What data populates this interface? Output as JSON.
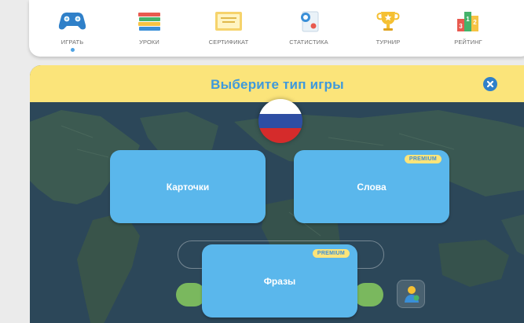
{
  "nav": {
    "items": [
      {
        "label": "ИГРАТЬ",
        "icon": "gamepad-icon",
        "active": true
      },
      {
        "label": "УРОКИ",
        "icon": "books-icon",
        "active": false
      },
      {
        "label": "СЕРТИФИКАТ",
        "icon": "certificate-icon",
        "active": false
      },
      {
        "label": "СТАТИСТИКА",
        "icon": "statistics-icon",
        "active": false
      },
      {
        "label": "ТУРНИР",
        "icon": "trophy-icon",
        "active": false
      },
      {
        "label": "РЕЙТИНГ",
        "icon": "podium-icon",
        "active": false
      }
    ],
    "podium": {
      "first": "1",
      "second": "2",
      "third": "3"
    }
  },
  "panel": {
    "title": "Выберите тип игры",
    "close_icon": "close-icon",
    "flag": "russia-flag-icon"
  },
  "games": [
    {
      "label": "Карточки",
      "premium": false
    },
    {
      "label": "Слова",
      "premium": true,
      "badge": "PREMIUM"
    },
    {
      "label": "Фразы",
      "premium": true,
      "badge": "PREMIUM"
    }
  ],
  "colors": {
    "accent": "#3e99dc",
    "header_bg": "#fbe47a",
    "card": "#5ab7ec",
    "map_bg": "#2e4b5d",
    "premium_bg": "#fbe47a"
  }
}
